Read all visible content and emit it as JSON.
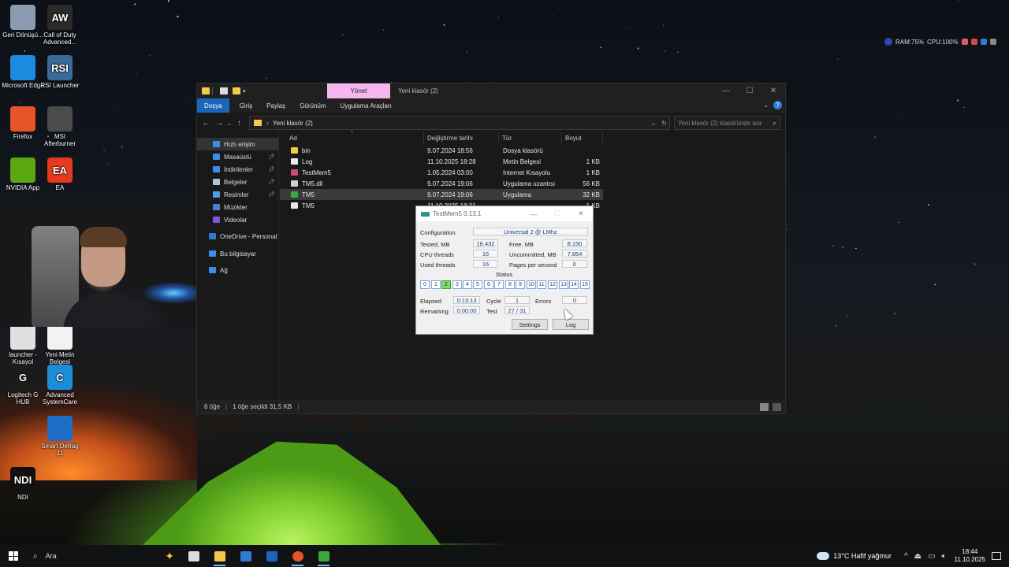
{
  "desktop": {
    "icons": [
      {
        "label": "Geri Dönüşü...",
        "icon": "recycle-bin-icon",
        "color": "#8a9bb0"
      },
      {
        "label": "Call of Duty Advanced...",
        "icon": "call-of-duty-icon",
        "color": "#2a2a2a",
        "glyph": "AW"
      },
      {
        "label": "Microsoft Edge",
        "icon": "edge-icon",
        "color": "#1b8adf"
      },
      {
        "label": "RSI Launcher",
        "icon": "rsi-launcher-icon",
        "color": "#3a6a9a",
        "glyph": "RSI"
      },
      {
        "label": "Firefox",
        "icon": "firefox-icon",
        "color": "#e8542a"
      },
      {
        "label": "MSI Afterburner",
        "icon": "msi-afterburner-icon",
        "color": "#4b4b4b"
      },
      {
        "label": "NVIDIA App",
        "icon": "nvidia-icon",
        "color": "#59a812"
      },
      {
        "label": "EA",
        "icon": "ea-icon",
        "color": "#e63a1e",
        "glyph": "EA"
      },
      {
        "label": "launcher - Kısayol",
        "icon": "launcher-shortcut-icon",
        "color": "#e0e0e0"
      },
      {
        "label": "Yeni Metin Belgesi",
        "icon": "text-document-icon",
        "color": "#f2f2f2"
      },
      {
        "label": "Logitech G HUB",
        "icon": "logitech-ghub-icon",
        "color": "#1b1b1b",
        "glyph": "G"
      },
      {
        "label": "Advanced SystemCare",
        "icon": "advanced-systemcare-icon",
        "color": "#1c8ed8",
        "glyph": "C"
      },
      {
        "label": "Smart Defrag 11",
        "icon": "smart-defrag-icon",
        "color": "#1e6ec8"
      },
      {
        "label": "NDI",
        "icon": "ndi-icon",
        "color": "#111111",
        "glyph": "NDI"
      }
    ]
  },
  "sysmon": {
    "ram": "RAM:75%",
    "cpu": "CPU:100%"
  },
  "explorer": {
    "qa_manage": "Yönet",
    "title": "Yeni klasör (2)",
    "ribbon_tabs": [
      "Dosya",
      "Giriş",
      "Paylaş",
      "Görünüm",
      "Uygulama Araçları"
    ],
    "breadcrumb": "Yeni klasör (2)",
    "search_placeholder": "Yeni klasör (2) klasöründe ara",
    "nav": [
      {
        "label": "Hızlı erişim",
        "icon": "star-icon",
        "color": "#3a8ee6",
        "pinned": false
      },
      {
        "label": "Masaüstü",
        "icon": "desktop-icon",
        "color": "#3a8ee6",
        "pinned": true
      },
      {
        "label": "İndirilenler",
        "icon": "download-icon",
        "color": "#3a8ee6",
        "pinned": true
      },
      {
        "label": "Belgeler",
        "icon": "documents-icon",
        "color": "#b8c4d0",
        "pinned": true
      },
      {
        "label": "Resimler",
        "icon": "pictures-icon",
        "color": "#4aa0e6",
        "pinned": true
      },
      {
        "label": "Müzikler",
        "icon": "music-icon",
        "color": "#4a7fd6",
        "pinned": false
      },
      {
        "label": "Videolar",
        "icon": "videos-icon",
        "color": "#7a5ad6",
        "pinned": false
      },
      {
        "label": "OneDrive - Personal",
        "icon": "onedrive-icon",
        "color": "#2d7bd3",
        "pinned": false
      },
      {
        "label": "Bu bilgisayar",
        "icon": "this-pc-icon",
        "color": "#3a8ee6",
        "pinned": false
      },
      {
        "label": "Ağ",
        "icon": "network-icon",
        "color": "#3a8ee6",
        "pinned": false
      }
    ],
    "columns": [
      "Ad",
      "Değiştirme tarihi",
      "Tür",
      "Boyut"
    ],
    "rows": [
      {
        "name": "bin",
        "date": "9.07.2024 18:56",
        "type": "Dosya klasörü",
        "size": "",
        "icon": "folder-icon",
        "color": "#f3c94b"
      },
      {
        "name": "Log",
        "date": "11.10.2025 18:28",
        "type": "Metin Belgesi",
        "size": "1 KB",
        "icon": "text-file-icon",
        "color": "#e8e8e8"
      },
      {
        "name": "TestMem5",
        "date": "1.05.2024 03:00",
        "type": "Internet Kısayolu",
        "size": "1 KB",
        "icon": "internet-shortcut-icon",
        "color": "#d04a6a"
      },
      {
        "name": "TM5.dll",
        "date": "9.07.2024 19:06",
        "type": "Uygulama uzantısı",
        "size": "56 KB",
        "icon": "dll-file-icon",
        "color": "#cfcfcf"
      },
      {
        "name": "TM5",
        "date": "9.07.2024 19:06",
        "type": "Uygulama",
        "size": "32 KB",
        "icon": "tm5-app-icon",
        "color": "#3aa83a"
      },
      {
        "name": "TM5",
        "date": "11.10.2025 18:21",
        "type": "",
        "size": "1 KB",
        "icon": "config-file-icon",
        "color": "#e8e8e8"
      }
    ],
    "selected_row": 4,
    "status": {
      "count": "6 öğe",
      "selection": "1 öğe seçildi 31,5 KB"
    }
  },
  "tm5": {
    "title": "TestMem5  0.13.1",
    "config_label": "Configuration",
    "config_value": "Universal 2 @ LMhz",
    "tested_label": "Tested, MB",
    "tested_value": "18.432",
    "free_label": "Free, MB",
    "free_value": "8.190",
    "cpu_threads_label": "CPU threads",
    "cpu_threads_value": "16",
    "uncommitted_label": "Uncommitted, MB",
    "uncommitted_value": "7.854",
    "used_threads_label": "Used threads",
    "used_threads_value": "16",
    "pps_label": "Pages per second",
    "pps_value": "0",
    "status_label": "Status",
    "status_cells": [
      "0",
      "1",
      "2",
      "3",
      "4",
      "5",
      "6",
      "7",
      "8",
      "9",
      "10",
      "11",
      "12",
      "13",
      "14",
      "15"
    ],
    "current_cell": 2,
    "elapsed_label": "Elapsed",
    "elapsed_value": "0:13:13",
    "cycle_label": "Cycle",
    "cycle_value": "1",
    "errors_label": "Errors",
    "errors_value": "0",
    "remaining_label": "Remaining",
    "remaining_value": "0:00:00",
    "test_label": "Test",
    "test_value": "27 / 31",
    "settings_button": "Settings",
    "log_button": "Log"
  },
  "taskbar": {
    "search_label": "Ara",
    "apps": [
      {
        "icon": "task-view-icon",
        "color": "#dddddd",
        "active": false
      },
      {
        "icon": "file-explorer-icon",
        "color": "#f3c94b",
        "active": true
      },
      {
        "icon": "microsoft-store-icon",
        "color": "#2d7bd3",
        "active": false
      },
      {
        "icon": "outlook-icon",
        "color": "#1a66b8",
        "active": false
      },
      {
        "icon": "firefox-icon",
        "color": "#e8542a",
        "active": true
      },
      {
        "icon": "testmem5-icon",
        "color": "#3aa83a",
        "active": true
      }
    ],
    "weather": "13°C  Hafif yağmur",
    "time": "18:44",
    "date": "11.10.2025"
  }
}
